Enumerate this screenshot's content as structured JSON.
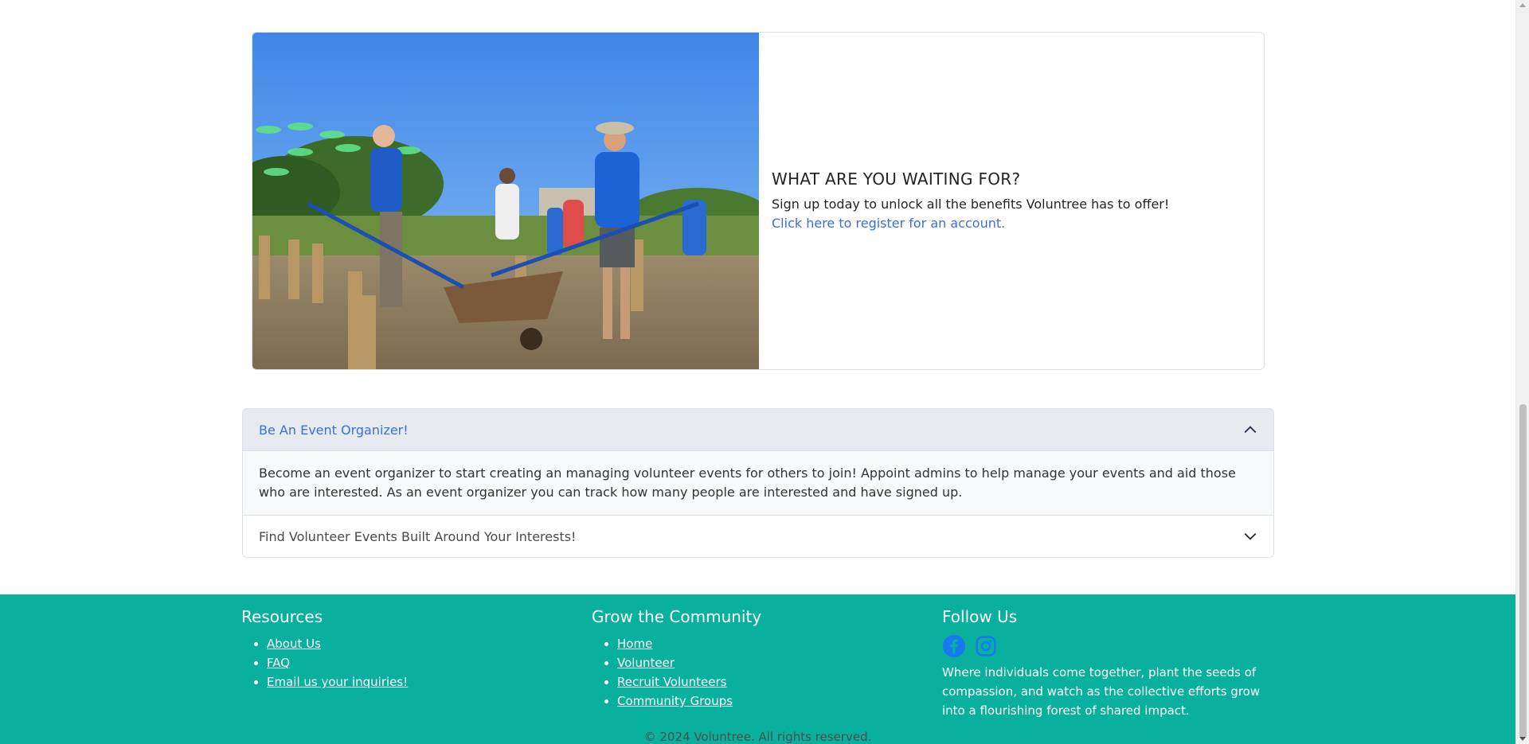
{
  "hero": {
    "title": "WHAT ARE YOU WAITING FOR?",
    "text": "Sign up today to unlock all the benefits Voluntree has to offer!",
    "link": "Click here to register for an account."
  },
  "accordion": {
    "items": [
      {
        "title": "Be An Event Organizer!",
        "expanded": true,
        "body": "Become an event organizer to start creating an managing volunteer events for others to join! Appoint admins to help manage your events and aid those who are interested. As an event organizer you can track how many people are interested and have signed up."
      },
      {
        "title": "Find Volunteer Events Built Around Your Interests!",
        "expanded": false
      }
    ]
  },
  "footer": {
    "resources": {
      "title": "Resources",
      "links": [
        "About Us",
        "FAQ",
        "Email us your inquiries!"
      ]
    },
    "community": {
      "title": "Grow the Community",
      "links": [
        "Home",
        "Volunteer",
        "Recruit Volunteers",
        "Community Groups"
      ]
    },
    "follow": {
      "title": "Follow Us",
      "icons": [
        "facebook-icon",
        "instagram-icon"
      ],
      "tagline": "Where individuals come together, plant the seeds of compassion, and watch as the collective efforts grow into a flourishing forest of shared impact."
    },
    "copyright": "© 2024 Voluntree. All rights reserved."
  },
  "colors": {
    "footer_bg": "#09b09e",
    "link": "#3a6fe0",
    "accordion_header_bg": "#e7eaee"
  }
}
